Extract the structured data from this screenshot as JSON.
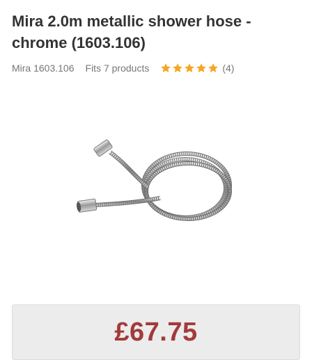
{
  "product": {
    "title": "Mira 2.0m metallic shower hose - chrome (1603.106)",
    "code": "Mira 1603.106",
    "fits": "Fits 7 products",
    "rating": 5,
    "review_count": "(4)",
    "price": "£67.75"
  },
  "colors": {
    "star": "#f5a623",
    "price": "#a33a3a",
    "price_box_bg": "#ececec"
  },
  "icons": {
    "star": "star-icon"
  }
}
